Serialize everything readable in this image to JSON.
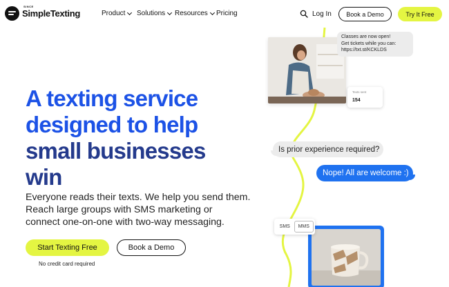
{
  "brand": {
    "since": "SINCE",
    "name": "SimpleTexting"
  },
  "nav": {
    "items": [
      {
        "label": "Product",
        "dropdown": true
      },
      {
        "label": "Solutions",
        "dropdown": true
      },
      {
        "label": "Resources",
        "dropdown": true
      },
      {
        "label": "Pricing",
        "dropdown": false
      }
    ],
    "search_icon": "search-icon",
    "login_label": "Log In",
    "book_demo_label": "Book a Demo",
    "try_label": "Try It Free"
  },
  "hero": {
    "headline_lines": [
      "A texting service",
      "designed to help",
      "small businesses",
      "win"
    ],
    "subtext_lines": [
      "Everyone reads their texts. We help you send them.",
      "Reach large groups with SMS marketing or",
      "connect one-on-one with two-way messaging."
    ],
    "primary_cta": "Start Texting Free",
    "secondary_cta": "Book a Demo",
    "note": "No credit card required"
  },
  "visual": {
    "promo_message_lines": [
      "Classes are now open!",
      "Get tickets while you can:",
      "https://txt.st/KCKLDS"
    ],
    "texts_sent_label": "Texts sent",
    "texts_sent_value": "154",
    "incoming_message": "Is prior experience required?",
    "outgoing_message": "Nope! All are welcome :)",
    "toggle": {
      "options": [
        "SMS",
        "MMS"
      ],
      "selected": "MMS"
    }
  },
  "colors": {
    "accent_yellow": "#e4f542",
    "headline_blue": "#1c52e6",
    "headline_navy": "#243a8c",
    "bubble_blue": "#1f72f0",
    "bubble_gray": "#ececec"
  }
}
